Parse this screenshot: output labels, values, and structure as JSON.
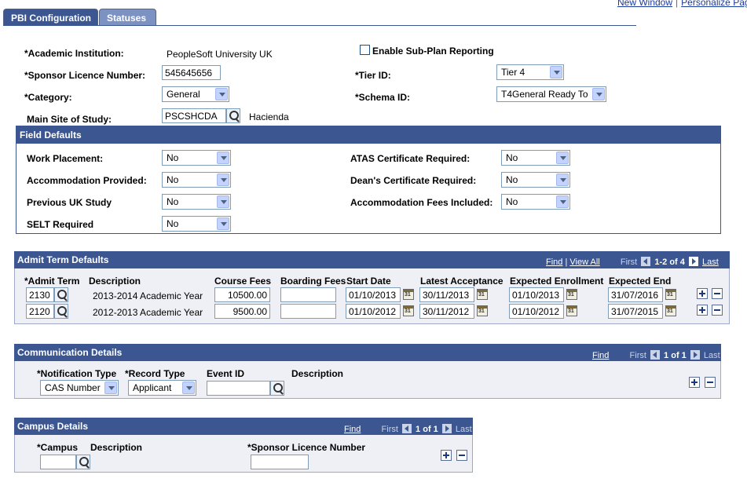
{
  "top_links": {
    "new_window": "New Window",
    "personalize": "Personalize Page"
  },
  "tabs": [
    {
      "label": "PBI Configuration"
    },
    {
      "label": "Statuses"
    }
  ],
  "form": {
    "academic_institution_label": "*Academic Institution:",
    "academic_institution_value": "PeopleSoft University UK",
    "enable_subplan_label": "Enable Sub-Plan Reporting",
    "sponsor_licence_label": "*Sponsor Licence Number:",
    "sponsor_licence_value": "545645656",
    "tier_id_label": "*Tier ID:",
    "tier_id_value": "Tier 4",
    "category_label": "*Category:",
    "category_value": "General",
    "schema_id_label": "*Schema ID:",
    "schema_id_value": "T4General Ready To",
    "main_site_label": "Main Site of Study:",
    "main_site_value": "PSCSHCDA",
    "main_site_desc": "Hacienda"
  },
  "field_defaults": {
    "title": "Field Defaults",
    "work_placement_label": "Work Placement:",
    "work_placement_value": "No",
    "accommodation_provided_label": "Accommodation Provided:",
    "accommodation_provided_value": "No",
    "previous_uk_study_label": "Previous UK Study",
    "previous_uk_study_value": "No",
    "selt_required_label": "SELT Required",
    "selt_required_value": "No",
    "atas_label": "ATAS Certificate Required:",
    "atas_value": "No",
    "deans_label": "Dean's Certificate Required:",
    "deans_value": "No",
    "accom_fees_label": "Accommodation Fees Included:",
    "accom_fees_value": "No"
  },
  "admit_term": {
    "title": "Admit Term Defaults",
    "find": "Find",
    "view_all": "View All",
    "first": "First",
    "range": "1-2 of 4",
    "last": "Last",
    "columns": {
      "admit_term": "*Admit Term",
      "description": "Description",
      "course_fees": "Course Fees",
      "boarding_fees": "Boarding Fees",
      "start_date": "Start Date",
      "latest_acceptance": "Latest Acceptance",
      "expected_enrollment": "Expected Enrollment",
      "expected_end": "Expected End"
    },
    "rows": [
      {
        "term": "2130",
        "description": "2013-2014 Academic Year",
        "course_fees": "10500.00",
        "boarding_fees": "",
        "start_date": "01/10/2013",
        "latest_acceptance": "30/11/2013",
        "expected_enrollment": "01/10/2013",
        "expected_end": "31/07/2016"
      },
      {
        "term": "2120",
        "description": "2012-2013 Academic Year",
        "course_fees": "9500.00",
        "boarding_fees": "",
        "start_date": "01/10/2012",
        "latest_acceptance": "30/11/2012",
        "expected_enrollment": "01/10/2012",
        "expected_end": "31/07/2015"
      }
    ]
  },
  "communication": {
    "title": "Communication Details",
    "find": "Find",
    "first": "First",
    "range": "1 of 1",
    "last": "Last",
    "notification_type_label": "*Notification Type",
    "notification_type_value": "CAS Number",
    "record_type_label": "*Record Type",
    "record_type_value": "Applicant",
    "event_id_label": "Event ID",
    "event_id_value": "",
    "description_label": "Description"
  },
  "campus": {
    "title": "Campus Details",
    "find": "Find",
    "first": "First",
    "range": "1 of 1",
    "last": "Last",
    "campus_label": "*Campus",
    "description_label": "Description",
    "sponsor_licence_label": "*Sponsor Licence Number",
    "campus_value": "",
    "sponsor_licence_value": ""
  }
}
